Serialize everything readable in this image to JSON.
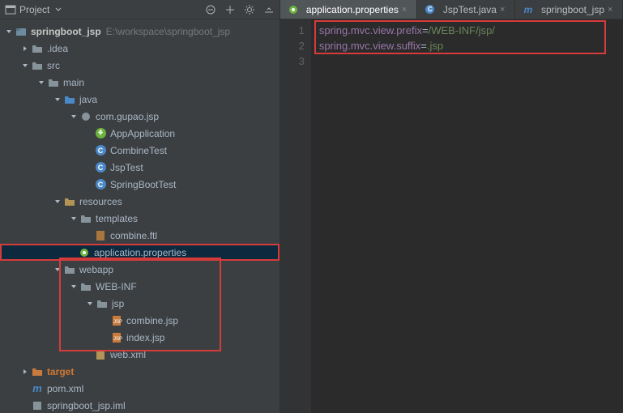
{
  "toolbar": {
    "project_label": "Project"
  },
  "tree": {
    "root": {
      "name": "springboot_jsp",
      "path": "E:\\workspace\\springboot_jsp"
    },
    "idea": ".idea",
    "src": "src",
    "main": "main",
    "java": "java",
    "pkg": "com.gupao.jsp",
    "class1": "AppApplication",
    "class2": "CombineTest",
    "class3": "JspTest",
    "class4": "SpringBootTest",
    "resources": "resources",
    "templates": "templates",
    "combine_ftl": "combine.ftl",
    "app_props": "application.properties",
    "webapp": "webapp",
    "webinf": "WEB-INF",
    "jsp_dir": "jsp",
    "combine_jsp": "combine.jsp",
    "index_jsp": "index.jsp",
    "web_xml": "web.xml",
    "target": "target",
    "pom": "pom.xml",
    "iml": "springboot_jsp.iml"
  },
  "tabs": {
    "t1": "application.properties",
    "t2": "JspTest.java",
    "t3": "springboot_jsp"
  },
  "code": {
    "line1_key": "spring.mvc.view.prefix",
    "line1_val": "/WEB-INF/jsp/",
    "line2_key": "spring.mvc.view.suffix",
    "line2_val": ".jsp",
    "ln1": "1",
    "ln2": "2",
    "ln3": "3"
  }
}
